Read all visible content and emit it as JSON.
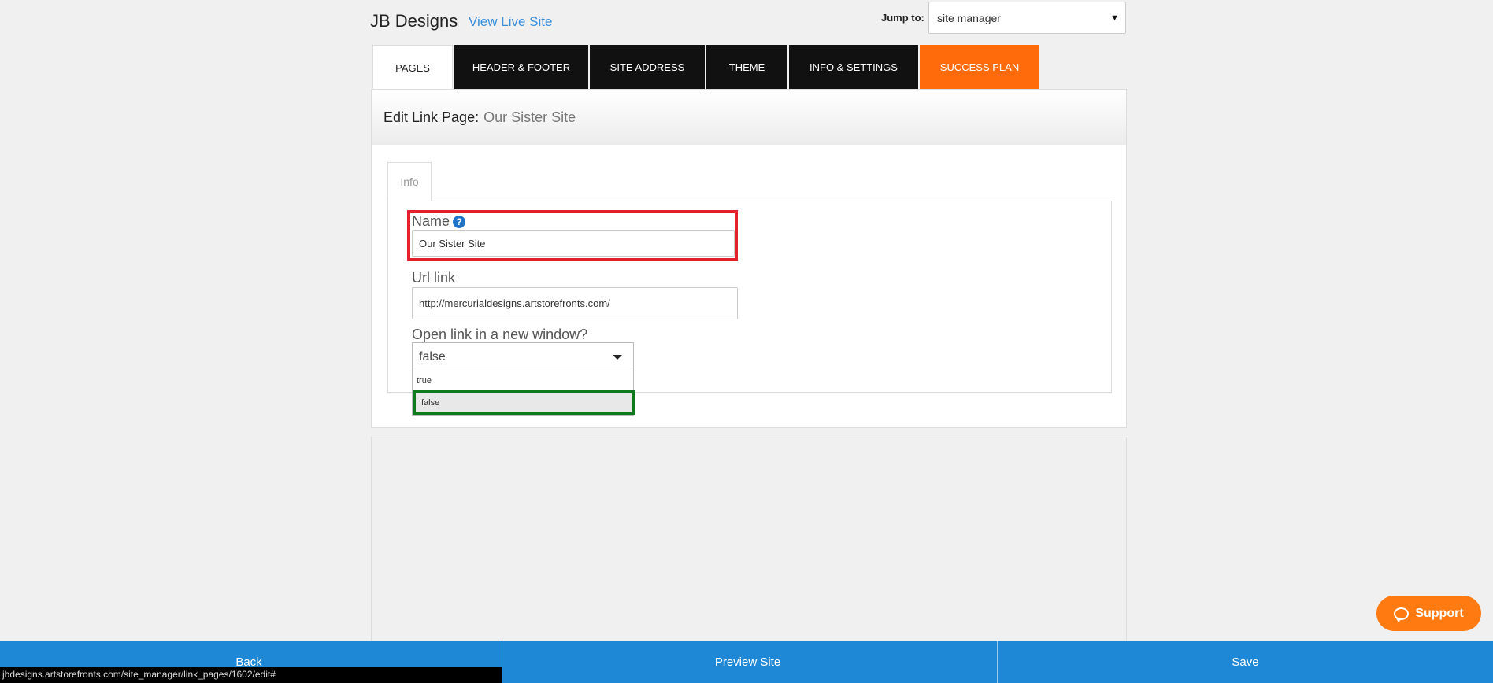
{
  "header": {
    "site_title": "JB Designs",
    "view_live_label": "View Live Site",
    "jump_label": "Jump to:",
    "jump_value": "site manager"
  },
  "tabs": [
    {
      "label": "PAGES",
      "active": true
    },
    {
      "label": "HEADER & FOOTER"
    },
    {
      "label": "SITE ADDRESS"
    },
    {
      "label": "THEME"
    },
    {
      "label": "INFO & SETTINGS"
    },
    {
      "label": "SUCCESS PLAN",
      "accent": "#ff6b0a"
    }
  ],
  "panel": {
    "title": "Edit Link Page:",
    "subtitle": "Our Sister Site",
    "info_tab": "Info"
  },
  "form": {
    "name_label": "Name",
    "name_value": "Our Sister Site",
    "url_label": "Url link",
    "url_value": "http://mercurialdesigns.artstorefronts.com/",
    "new_window_label": "Open link in a new window?",
    "new_window_value": "false",
    "new_window_options": [
      "true",
      "false"
    ]
  },
  "support_label": "Support",
  "bottom_bar": {
    "back": "Back",
    "preview": "Preview Site",
    "save": "Save"
  },
  "status_url": "jbdesigns.artstorefronts.com/site_manager/link_pages/1602/edit#",
  "colors": {
    "accent_blue": "#1e88d6",
    "orange": "#ff6b0a",
    "highlight_red": "#e3202d",
    "highlight_green": "#0d7a1e"
  }
}
